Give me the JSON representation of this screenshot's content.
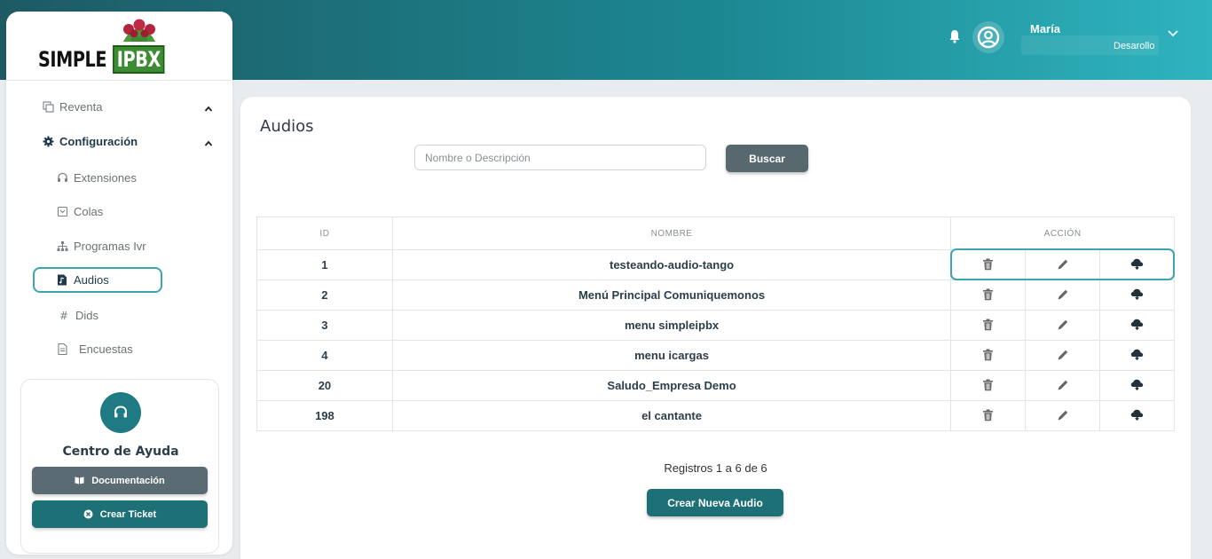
{
  "brand": {
    "logo_plain": "SIMPLE",
    "logo_box": "IPBX"
  },
  "header": {
    "user_name": "María",
    "user_role": "Desarollo"
  },
  "sidebar": {
    "items": [
      {
        "label": "Reventa"
      },
      {
        "label": "Configuración"
      },
      {
        "label": "Extensiones"
      },
      {
        "label": "Colas"
      },
      {
        "label": "Programas Ivr"
      },
      {
        "label": "Audios"
      },
      {
        "label": "Dids"
      },
      {
        "label": "Encuestas"
      }
    ],
    "help": {
      "title": "Centro de Ayuda",
      "doc_label": "Documentación",
      "ticket_label": "Crear Ticket"
    }
  },
  "main": {
    "title": "Audios",
    "search": {
      "placeholder": "Nombre o Descripción",
      "value": ""
    },
    "search_button": "Buscar",
    "table": {
      "columns": [
        "ID",
        "NOMBRE",
        "ACCIÓN"
      ],
      "rows": [
        {
          "id": "1",
          "name": "testeando-audio-tango"
        },
        {
          "id": "2",
          "name": "Menú Principal Comuniquemonos"
        },
        {
          "id": "3",
          "name": "menu simpleipbx"
        },
        {
          "id": "4",
          "name": "menu icargas"
        },
        {
          "id": "20",
          "name": "Saludo_Empresa Demo"
        },
        {
          "id": "198",
          "name": "el cantante"
        }
      ]
    },
    "records_text": "Registros 1 a 6 de 6",
    "create_button": "Crear Nueva Audio"
  },
  "colors": {
    "accent": "#1e7077",
    "highlight_border": "#3da5ae",
    "secondary_button": "#57686f"
  }
}
